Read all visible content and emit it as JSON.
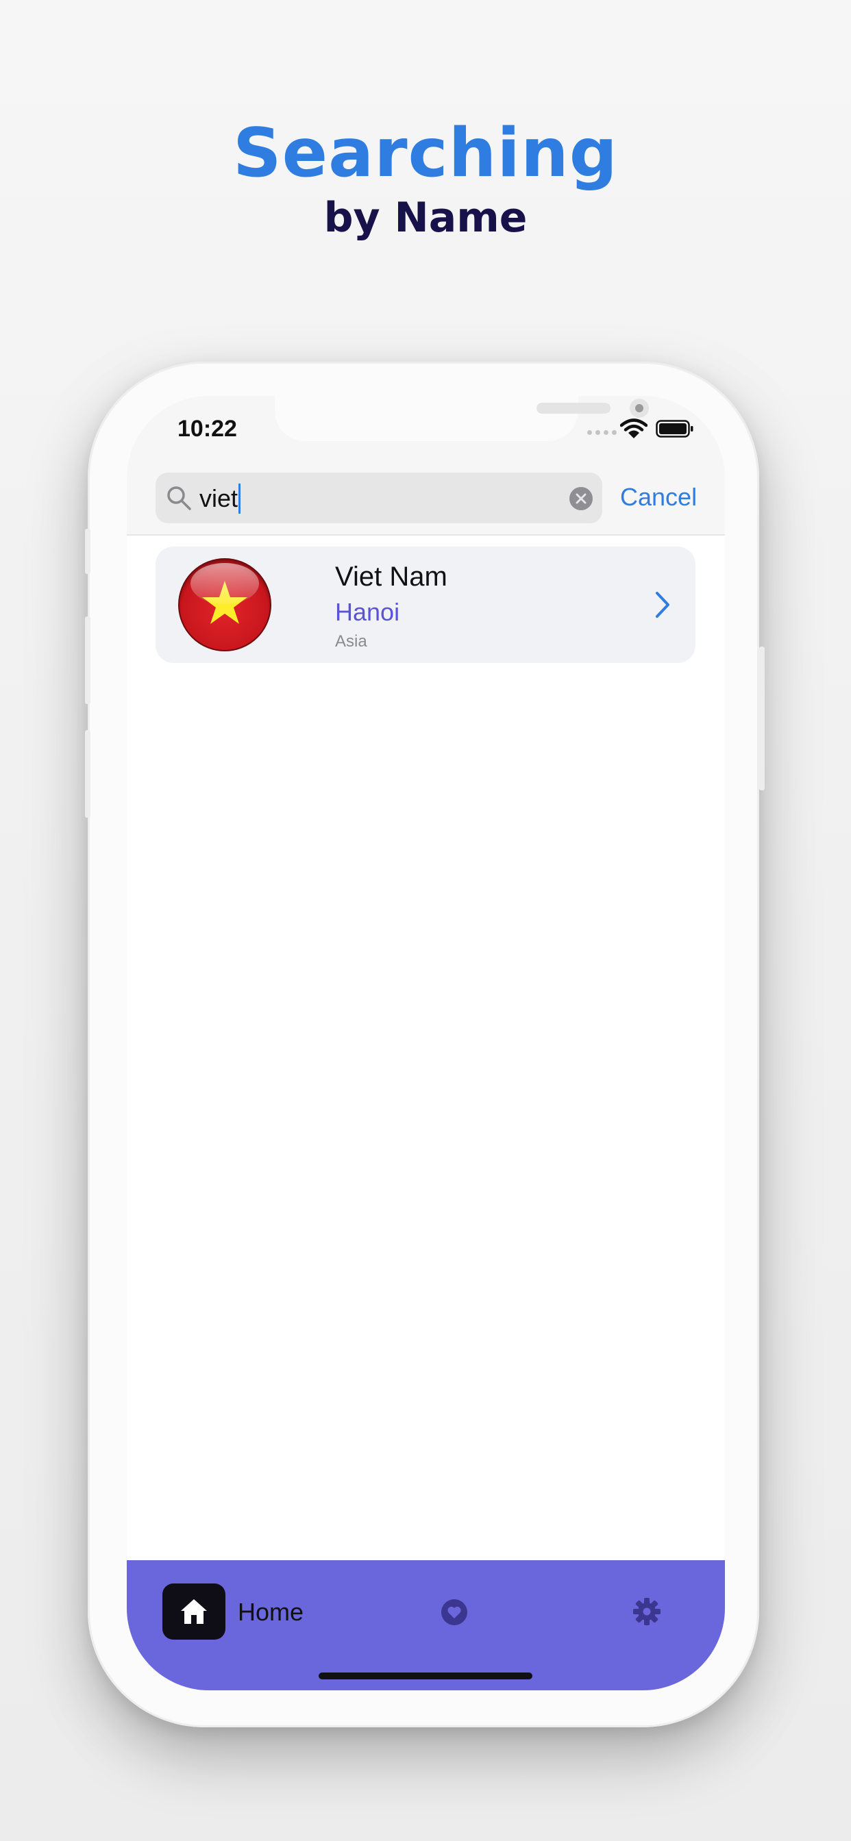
{
  "heading": {
    "title": "Searching",
    "subtitle": "by Name"
  },
  "status_bar": {
    "time": "10:22"
  },
  "search": {
    "query": "viet",
    "cancel_label": "Cancel"
  },
  "results": [
    {
      "country": "Viet Nam",
      "capital": "Hanoi",
      "region": "Asia",
      "flag": "vietnam-flag"
    }
  ],
  "tab_bar": {
    "home_label": "Home",
    "icons": [
      "home-icon",
      "heart-icon",
      "gear-icon"
    ],
    "background_color": "#6a66dc"
  },
  "colors": {
    "title": "#2f7de0",
    "subtitle": "#17134a",
    "accent": "#2f7de0",
    "capital_text": "#5b53d6"
  }
}
